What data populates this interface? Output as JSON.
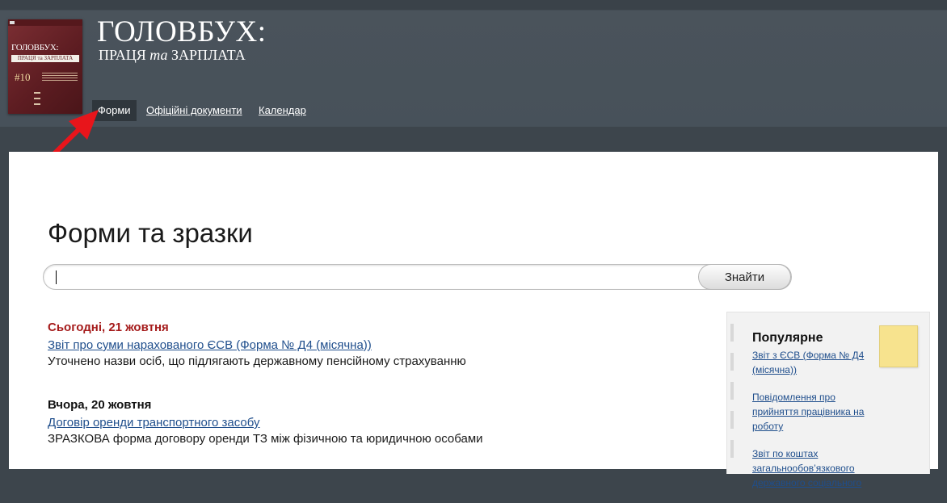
{
  "header": {
    "cover": {
      "title": "ГОЛОВБУХ:",
      "subtitle": "ПРАЦЯ та ЗАРПЛАТА",
      "issue": "#10"
    },
    "brand_title": "ГОЛОВБУХ:",
    "brand_sub_a": "ПРАЦЯ ",
    "brand_sub_b": "та",
    "brand_sub_c": " ЗАРПЛАТА",
    "nav": [
      {
        "label": "Форми",
        "active": true
      },
      {
        "label": "Офіційні документи",
        "active": false
      },
      {
        "label": "Календар",
        "active": false
      }
    ]
  },
  "main": {
    "title": "Форми та зразки",
    "search": {
      "value": "",
      "button_label": "Знайти"
    },
    "feed": [
      {
        "date": "Сьогодні, 21 жовтня",
        "link": "Звіт про суми нарахованого ЄСВ (Форма № Д4 (місячна))",
        "description": "Уточнено назви осіб, що підлягають державному пенсійному страхуванню"
      },
      {
        "date": "Вчора, 20 жовтня",
        "link": "Договір оренди транспортного засобу",
        "description": "ЗРАЗКОВА форма договору оренди ТЗ між фізичною та юридичною особами"
      }
    ]
  },
  "sidebar": {
    "title": "Популярне",
    "items": [
      "Звіт з ЄСВ (Форма № Д4 (місячна))",
      "Повідомлення про прийняття працівника на роботу",
      "Звіт по коштах загальнообов’язкового державного соціального"
    ]
  },
  "colors": {
    "header_bg": "#47515a",
    "page_bg": "#3d454c",
    "today_date": "#a51b1b",
    "link": "#1f4e8c",
    "note": "#f7e38e",
    "arrow": "#e8151b"
  }
}
